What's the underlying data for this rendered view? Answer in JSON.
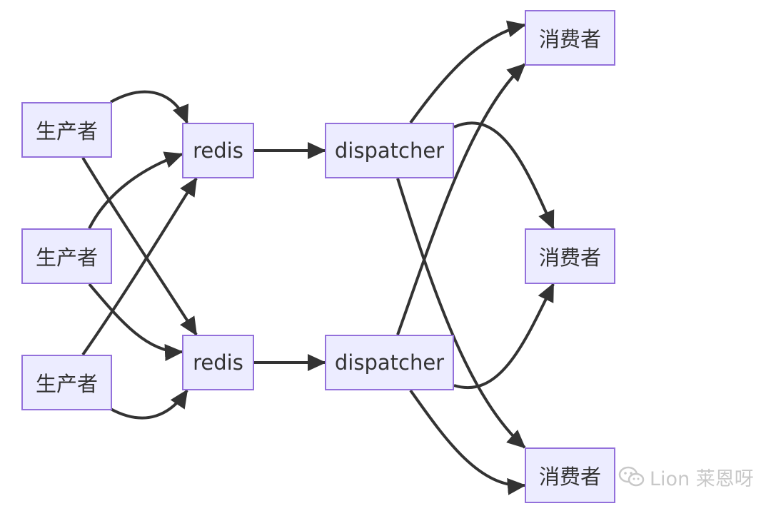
{
  "diagram": {
    "nodes": [
      {
        "id": "p1",
        "label": "生产者"
      },
      {
        "id": "p2",
        "label": "生产者"
      },
      {
        "id": "p3",
        "label": "生产者"
      },
      {
        "id": "r1",
        "label": "redis"
      },
      {
        "id": "r2",
        "label": "redis"
      },
      {
        "id": "d1",
        "label": "dispatcher"
      },
      {
        "id": "d2",
        "label": "dispatcher"
      },
      {
        "id": "c1",
        "label": "消费者"
      },
      {
        "id": "c2",
        "label": "消费者"
      },
      {
        "id": "c3",
        "label": "消费者"
      }
    ],
    "edges": [
      {
        "from": "p1",
        "to": "r1"
      },
      {
        "from": "p1",
        "to": "r2"
      },
      {
        "from": "p2",
        "to": "r1"
      },
      {
        "from": "p2",
        "to": "r2"
      },
      {
        "from": "p3",
        "to": "r1"
      },
      {
        "from": "p3",
        "to": "r2"
      },
      {
        "from": "r1",
        "to": "d1"
      },
      {
        "from": "r2",
        "to": "d2"
      },
      {
        "from": "d1",
        "to": "c1"
      },
      {
        "from": "d1",
        "to": "c2"
      },
      {
        "from": "d1",
        "to": "c3"
      },
      {
        "from": "d2",
        "to": "c1"
      },
      {
        "from": "d2",
        "to": "c2"
      },
      {
        "from": "d2",
        "to": "c3"
      }
    ]
  },
  "watermark": {
    "text": "Lion 莱恩呀",
    "icon": "wechat-icon"
  },
  "colors": {
    "node_fill": "#ececff",
    "node_border": "#9370db",
    "edge": "#333333",
    "text": "#333333",
    "watermark": "#c8c8c8"
  }
}
